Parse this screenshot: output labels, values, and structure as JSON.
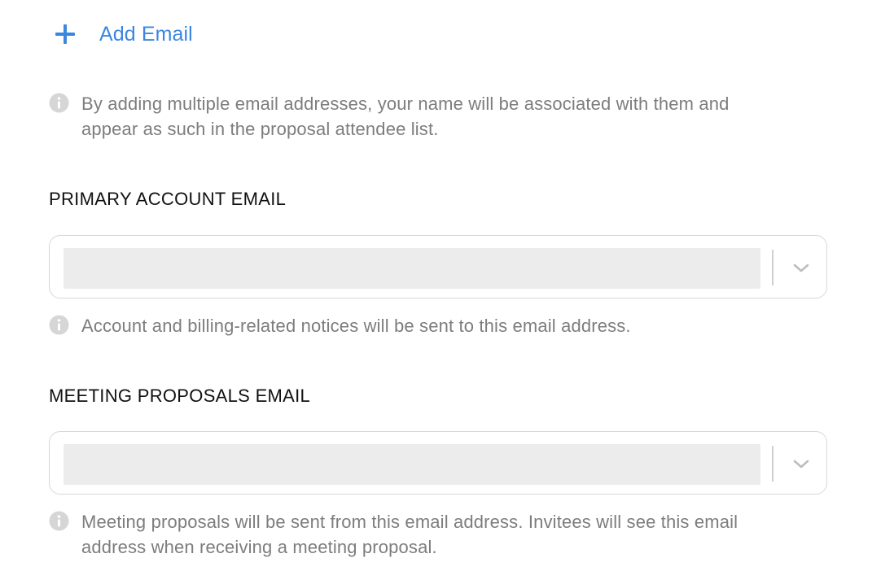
{
  "add_email": {
    "label": "Add Email",
    "icon": "plus-icon",
    "color": "#3c86e0"
  },
  "notes": {
    "multiple_emails": "By adding multiple email addresses, your name will be associated with them and",
    "multiple_emails_line2": "appear as such in the proposal attendee list."
  },
  "primary_account": {
    "title": "PRIMARY ACCOUNT EMAIL",
    "selected_value": "",
    "note": "Account and billing-related notices will be sent to this email address."
  },
  "meeting_proposals": {
    "title": "MEETING PROPOSALS EMAIL",
    "selected_value": "",
    "note_line1": "Meeting proposals will be sent from this email address. Invitees will see this email",
    "note_line2": "address when receiving a meeting proposal."
  },
  "icons": {
    "info": "info-icon",
    "dropdown": "chevron-down-icon"
  }
}
